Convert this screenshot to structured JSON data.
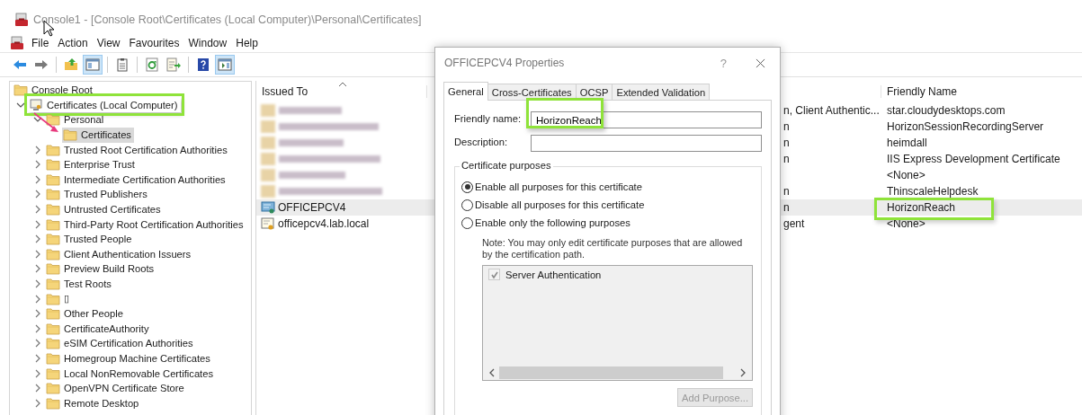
{
  "window": {
    "title": "Console1 - [Console Root\\Certificates (Local Computer)\\Personal\\Certificates]",
    "active": false
  },
  "menu": [
    "File",
    "Action",
    "View",
    "Favourites",
    "Window",
    "Help"
  ],
  "toolbar": [
    {
      "kind": "back",
      "pressed": false
    },
    {
      "kind": "forward",
      "pressed": false
    },
    {
      "kind": "separator"
    },
    {
      "kind": "up",
      "pressed": false
    },
    {
      "kind": "tree-toggle",
      "pressed": true
    },
    {
      "kind": "separator"
    },
    {
      "kind": "properties",
      "pressed": false
    },
    {
      "kind": "separator"
    },
    {
      "kind": "refresh",
      "pressed": false
    },
    {
      "kind": "export",
      "pressed": false
    },
    {
      "kind": "separator"
    },
    {
      "kind": "help",
      "pressed": false
    },
    {
      "kind": "action-pane",
      "pressed": true
    }
  ],
  "tree": {
    "label": "Console Root",
    "kind": "folder",
    "selected": false,
    "highlighted": false,
    "children": [
      {
        "label": "Certificates (Local Computer)",
        "kind": "computer",
        "expanded": true,
        "selected": false,
        "highlighted": true,
        "children": [
          {
            "label": "Personal",
            "kind": "folder",
            "expanded": true,
            "selected": false,
            "highlighted": false,
            "children": [
              {
                "label": "Certificates",
                "kind": "folder",
                "selected": true,
                "highlighted": false
              }
            ]
          },
          {
            "label": "Trusted Root Certification Authorities",
            "kind": "folder",
            "expanded": false,
            "selected": false,
            "highlighted": false
          },
          {
            "label": "Enterprise Trust",
            "kind": "folder",
            "expanded": false,
            "selected": false,
            "highlighted": false
          },
          {
            "label": "Intermediate Certification Authorities",
            "kind": "folder",
            "expanded": false,
            "selected": false,
            "highlighted": false
          },
          {
            "label": "Trusted Publishers",
            "kind": "folder",
            "expanded": false,
            "selected": false,
            "highlighted": false
          },
          {
            "label": "Untrusted Certificates",
            "kind": "folder",
            "expanded": false,
            "selected": false,
            "highlighted": false
          },
          {
            "label": "Third-Party Root Certification Authorities",
            "kind": "folder",
            "expanded": false,
            "selected": false,
            "highlighted": false
          },
          {
            "label": "Trusted People",
            "kind": "folder",
            "expanded": false,
            "selected": false,
            "highlighted": false
          },
          {
            "label": "Client Authentication Issuers",
            "kind": "folder",
            "expanded": false,
            "selected": false,
            "highlighted": false
          },
          {
            "label": "Preview Build Roots",
            "kind": "folder",
            "expanded": false,
            "selected": false,
            "highlighted": false
          },
          {
            "label": "Test Roots",
            "kind": "folder",
            "expanded": false,
            "selected": false,
            "highlighted": false
          },
          {
            "label": "▯",
            "kind": "folder",
            "expanded": false,
            "selected": false,
            "highlighted": false
          },
          {
            "label": "Other People",
            "kind": "folder",
            "expanded": false,
            "selected": false,
            "highlighted": false
          },
          {
            "label": "CertificateAuthority",
            "kind": "folder",
            "expanded": false,
            "selected": false,
            "highlighted": false
          },
          {
            "label": "eSIM Certification Authorities",
            "kind": "folder",
            "expanded": false,
            "selected": false,
            "highlighted": false
          },
          {
            "label": "Homegroup Machine Certificates",
            "kind": "folder",
            "expanded": false,
            "selected": false,
            "highlighted": false
          },
          {
            "label": "Local NonRemovable Certificates",
            "kind": "folder",
            "expanded": false,
            "selected": false,
            "highlighted": false
          },
          {
            "label": "OpenVPN Certificate Store",
            "kind": "folder",
            "expanded": false,
            "selected": false,
            "highlighted": false
          },
          {
            "label": "Remote Desktop",
            "kind": "folder",
            "expanded": false,
            "selected": false,
            "highlighted": false
          }
        ]
      }
    ]
  },
  "list": {
    "columns": [
      "Issued To",
      "Friendly Name"
    ],
    "rows": [
      {
        "kind": "redacted",
        "column_3": "n, Client Authentic...",
        "friendly_name": "star.cloudydesktops.com",
        "selected": false,
        "highlighted": false
      },
      {
        "kind": "redacted",
        "column_3": "n",
        "friendly_name": "HorizonSessionRecordingServer",
        "selected": false,
        "highlighted": false
      },
      {
        "kind": "redacted",
        "column_3": "n",
        "friendly_name": "heimdall",
        "selected": false,
        "highlighted": false
      },
      {
        "kind": "redacted",
        "column_3": "n",
        "friendly_name": "IIS Express Development Certificate",
        "selected": false,
        "highlighted": false
      },
      {
        "kind": "redacted",
        "friendly_name": "<None>",
        "selected": false,
        "highlighted": false
      },
      {
        "kind": "redacted",
        "column_3": "n",
        "friendly_name": "ThinscaleHelpdesk",
        "selected": false,
        "highlighted": false
      },
      {
        "kind": "ca",
        "issued_to": "OFFICEPCV4",
        "column_3": "n",
        "friendly_name": "HorizonReach",
        "selected": true,
        "highlighted": true
      },
      {
        "kind": "personal",
        "issued_to": "officepcv4.lab.local",
        "column_3": "gent",
        "friendly_name": "<None>",
        "selected": false,
        "highlighted": false
      }
    ]
  },
  "dialog": {
    "title": "OFFICEPCV4 Properties",
    "help": "?",
    "tabs": [
      {
        "label": "General",
        "selected": true
      },
      {
        "label": "Cross-Certificates",
        "selected": false
      },
      {
        "label": "OCSP",
        "selected": false
      },
      {
        "label": "Extended Validation",
        "selected": false
      }
    ],
    "friendly_name": {
      "label": "Friendly name:",
      "value": "HorizonReach",
      "highlighted": true
    },
    "description": {
      "label": "Description:"
    },
    "purposes": {
      "title": "Certificate purposes",
      "options": [
        {
          "label": "Enable all purposes for this certificate",
          "selected": true
        },
        {
          "label": "Disable all purposes for this certificate",
          "selected": false
        },
        {
          "label": "Enable only the following purposes",
          "selected": false
        }
      ],
      "note": "Note: You may only edit certificate purposes that are allowed by the certification path.",
      "items": [
        {
          "label": "Server Authentication",
          "checked": true,
          "disabled": true
        }
      ],
      "add_button": {
        "label": "Add Purpose...",
        "disabled": true
      }
    }
  }
}
